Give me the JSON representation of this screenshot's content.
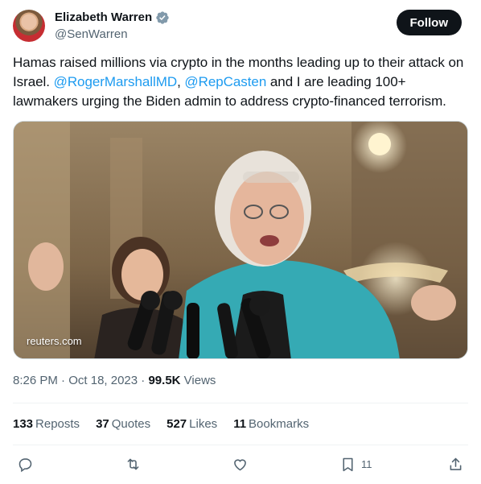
{
  "author": {
    "name": "Elizabeth Warren",
    "handle": "@SenWarren"
  },
  "follow_label": "Follow",
  "tweet": {
    "text_1": "Hamas raised millions via crypto in the months leading up to their attack on Israel. ",
    "mention_1": "@RogerMarshallMD",
    "text_2": ", ",
    "mention_2": "@RepCasten",
    "text_3": " and I are leading 100+ lawmakers urging the Biden admin to address crypto-financed terrorism."
  },
  "media": {
    "source": "reuters.com"
  },
  "meta": {
    "time": "8:26 PM",
    "sep1": " · ",
    "date": "Oct 18, 2023",
    "sep2": " · ",
    "views_count": "99.5K",
    "views_label": " Views"
  },
  "stats": [
    {
      "count": "133",
      "label": "Reposts"
    },
    {
      "count": "37",
      "label": "Quotes"
    },
    {
      "count": "527",
      "label": "Likes"
    },
    {
      "count": "11",
      "label": "Bookmarks"
    }
  ],
  "actions": {
    "bookmark_count": "11"
  },
  "icons": [
    "verified-badge-icon",
    "reply-icon",
    "repost-icon",
    "like-icon",
    "bookmark-icon",
    "share-icon"
  ],
  "colors": {
    "accent": "#1d9bf0",
    "text": "#0f1419",
    "muted": "#536471"
  }
}
